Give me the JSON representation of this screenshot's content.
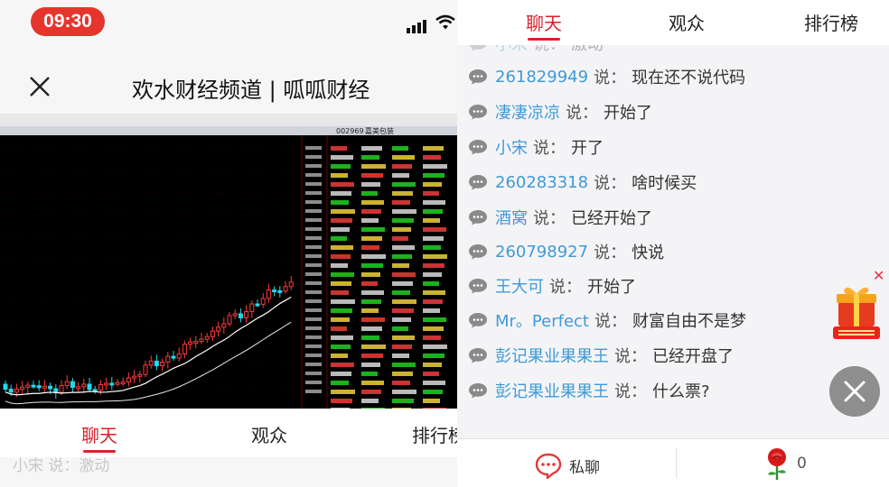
{
  "status_bar": {
    "time": "09:30"
  },
  "header": {
    "title": "欢水财经频道 | 呱呱财经"
  },
  "stock": {
    "code": "002969",
    "name": "嘉美包装"
  },
  "tabs": {
    "chat": "聊天",
    "audience": "观众",
    "ranking": "排行榜"
  },
  "tabs_left_visible": {
    "ranking_cut": "排行榜"
  },
  "ghost_message": "小宋 说：激动",
  "messages": [
    {
      "user": "小宋",
      "said": "说：",
      "text": "激动",
      "faded": true
    },
    {
      "user": "261829949",
      "said": "说：",
      "text": "现在还不说代码"
    },
    {
      "user": "凄凄凉凉",
      "said": "说：",
      "text": "开始了"
    },
    {
      "user": "小宋",
      "said": "说：",
      "text": "开了"
    },
    {
      "user": "260283318",
      "said": "说：",
      "text": "啥时候买"
    },
    {
      "user": "酒窝",
      "said": "说：",
      "text": "已经开始了"
    },
    {
      "user": "260798927",
      "said": "说：",
      "text": "快说"
    },
    {
      "user": "王大可",
      "said": "说：",
      "text": "开始了"
    },
    {
      "user": "Mr。Perfect",
      "said": "说：",
      "text": "财富自由不是梦"
    },
    {
      "user": "彭记果业果果王",
      "said": "说：",
      "text": "已经开盘了"
    },
    {
      "user": "彭记果业果果王",
      "said": "说：",
      "text": "什么票?"
    }
  ],
  "bottom_bar": {
    "private_chat": "私聊",
    "rose_count": "0"
  },
  "colors": {
    "accent": "#d8222a",
    "username": "#3f9ad7",
    "time_pill": "#e5352d"
  },
  "icons": [
    "close-icon",
    "signal-icon",
    "wifi-icon",
    "chat-bubble-icon",
    "private-chat-icon",
    "rose-icon",
    "gift-icon"
  ]
}
